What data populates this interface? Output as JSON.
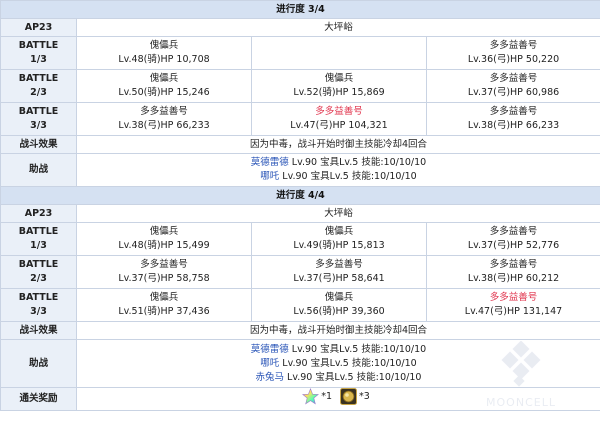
{
  "labels": {
    "ap": "AP23",
    "battle": "BATTLE",
    "effect": "战斗效果",
    "support": "助战",
    "reward": "通关奖励"
  },
  "sections": [
    {
      "header": "进行度 3/4",
      "location": "大坪峪",
      "battles": [
        {
          "wave": "1/3",
          "left": {
            "name": "傀儡兵",
            "info": "Lv.48(骑)HP 10,708",
            "highlight": false
          },
          "mid": {
            "name": "",
            "info": "",
            "highlight": false
          },
          "right": {
            "name": "多多益善号",
            "info": "Lv.36(弓)HP 50,220",
            "highlight": false
          }
        },
        {
          "wave": "2/3",
          "left": {
            "name": "傀儡兵",
            "info": "Lv.50(骑)HP 15,246",
            "highlight": false
          },
          "mid": {
            "name": "傀儡兵",
            "info": "Lv.52(骑)HP 15,869",
            "highlight": false
          },
          "right": {
            "name": "多多益善号",
            "info": "Lv.37(弓)HP 60,986",
            "highlight": false
          }
        },
        {
          "wave": "3/3",
          "left": {
            "name": "多多益善号",
            "info": "Lv.38(弓)HP 66,233",
            "highlight": false
          },
          "mid": {
            "name": "多多益善号",
            "info": "Lv.47(弓)HP 104,321",
            "highlight": true
          },
          "right": {
            "name": "多多益善号",
            "info": "Lv.38(弓)HP 66,233",
            "highlight": false
          }
        }
      ],
      "effect": "因为中毒，战斗开始时御主技能冷却4回合",
      "supports": [
        {
          "name": "莫德雷德",
          "detail": " Lv.90 宝具Lv.5 技能:10/10/10"
        },
        {
          "name": "哪吒",
          "detail": " Lv.90 宝具Lv.5 技能:10/10/10"
        }
      ]
    },
    {
      "header": "进行度 4/4",
      "location": "大坪峪",
      "battles": [
        {
          "wave": "1/3",
          "left": {
            "name": "傀儡兵",
            "info": "Lv.48(骑)HP 15,499",
            "highlight": false
          },
          "mid": {
            "name": "傀儡兵",
            "info": "Lv.49(骑)HP 15,813",
            "highlight": false
          },
          "right": {
            "name": "多多益善号",
            "info": "Lv.37(弓)HP 52,776",
            "highlight": false
          }
        },
        {
          "wave": "2/3",
          "left": {
            "name": "多多益善号",
            "info": "Lv.37(弓)HP 58,758",
            "highlight": false
          },
          "mid": {
            "name": "多多益善号",
            "info": "Lv.37(弓)HP 58,641",
            "highlight": false
          },
          "right": {
            "name": "多多益善号",
            "info": "Lv.38(弓)HP 60,212",
            "highlight": false
          }
        },
        {
          "wave": "3/3",
          "left": {
            "name": "傀儡兵",
            "info": "Lv.51(骑)HP 37,436",
            "highlight": false
          },
          "mid": {
            "name": "傀儡兵",
            "info": "Lv.56(骑)HP 39,360",
            "highlight": false
          },
          "right": {
            "name": "多多益善号",
            "info": "Lv.47(弓)HP 131,147",
            "highlight": true
          }
        }
      ],
      "effect": "因为中毒，战斗开始时御主技能冷却4回合",
      "supports": [
        {
          "name": "莫德雷德",
          "detail": " Lv.90 宝具Lv.5 技能:10/10/10"
        },
        {
          "name": "哪吒",
          "detail": " Lv.90 宝具Lv.5 技能:10/10/10"
        },
        {
          "name": "赤兔马",
          "detail": " Lv.90 宝具Lv.5 技能:10/10/10"
        }
      ],
      "rewards": [
        {
          "icon": "rainbow-star-icon",
          "qty": "*1"
        },
        {
          "icon": "golden-orb-icon",
          "qty": "*3"
        }
      ]
    }
  ],
  "watermark": "MOONCELL",
  "colors": {
    "header_bg": "#d5e1f2",
    "label_bg": "#eaf0f8",
    "border": "#c9d3e3",
    "highlight": "#e0304a",
    "link": "#2a55b7"
  }
}
